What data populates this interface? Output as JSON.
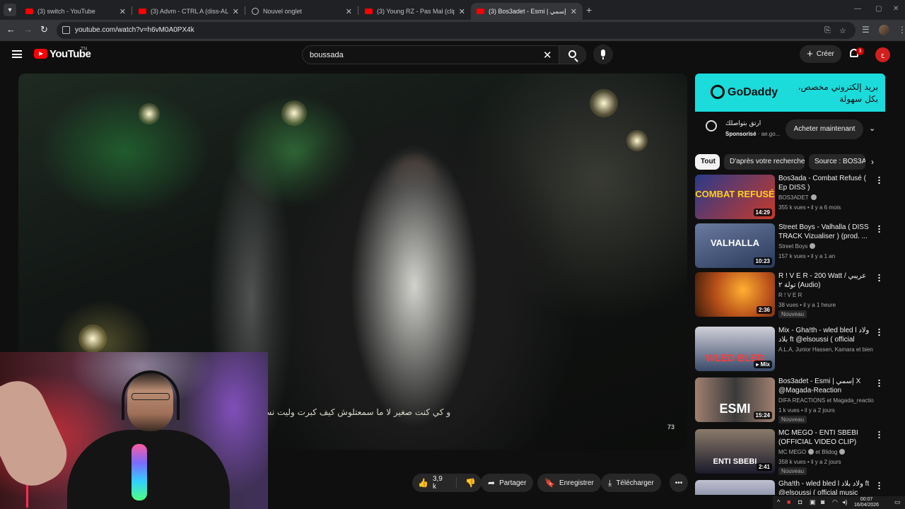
{
  "browser": {
    "tabs": [
      {
        "title": "(3) switch - YouTube",
        "type": "youtube",
        "active": false
      },
      {
        "title": "(3) Advm - CTRL A (diss-ALL) -",
        "type": "youtube",
        "active": false
      },
      {
        "title": "Nouvel onglet",
        "type": "globe",
        "active": false
      },
      {
        "title": "(3) Young RZ - Pas Mal (clip offi",
        "type": "youtube",
        "active": false
      },
      {
        "title": "(3) Bos3adet - Esmi | إسمي ( Of",
        "type": "youtube",
        "active": true
      }
    ],
    "url": "youtube.com/watch?v=h6vM0A0PX4k"
  },
  "header": {
    "logo_text": "YouTube",
    "country": "TN",
    "search_query": "boussada",
    "create_label": "Créer",
    "notification_count": "3",
    "avatar_letter": "خ"
  },
  "video": {
    "subtitle": "و كي كنت صغير لا ما سمعتلوش كيف كبرت وليت نسمع",
    "watermark": "73"
  },
  "actions": {
    "likes": "3,9 k",
    "share": "Partager",
    "save": "Enregistrer",
    "download": "Télécharger"
  },
  "ad": {
    "brand": "GoDaddy",
    "banner_text_line1": "بريد إلكتروني مخصص،",
    "banner_text_line2": "بكل سهولة",
    "title": "ارتق بتواصلك",
    "sponsored": "Sponsorisé",
    "domain": "ae.go...",
    "cta": "Acheter maintenant"
  },
  "chips": [
    "Tout",
    "D'après votre recherche",
    "Source : BOS3ADET"
  ],
  "recommendations": [
    {
      "title": "Bos3ada - Combat Refusé ( Ep DISS )",
      "channel": "BOS3ADET",
      "verified": true,
      "views": "355 k vues",
      "age": "il y a 6 mois",
      "duration": "14:29",
      "thumb_text": "COMBAT REFUSÉ",
      "badge": "",
      "colors": [
        "#2a3a8a",
        "#c83a2a"
      ]
    },
    {
      "title": "Street Boys - Valhalla ( DISS TRACK Vizualiser ) (prod. ...",
      "channel": "Street Boys",
      "verified": true,
      "views": "157 k vues",
      "age": "il y a 1 an",
      "duration": "10:23",
      "thumb_text": "VALHALLA",
      "badge": "",
      "colors": [
        "#2a3a5a",
        "#6a7aa0"
      ]
    },
    {
      "title": "R ! V E R - 200 Watt / عريبي تولة ٢ (Audio)",
      "channel": "R ! V E R",
      "verified": false,
      "views": "38 vues",
      "age": "il y a 1 heure",
      "duration": "2:36",
      "thumb_text": "",
      "badge": "Nouveau",
      "colors": [
        "#b8501a",
        "#ffb030"
      ]
    },
    {
      "title": "Mix - Gha!th - wled bled l ولاد بلاد ft @elsoussi ( official music ...",
      "channel": "A.L.A, Junior Hassen, Kamara et bien plus",
      "verified": false,
      "views": "",
      "age": "",
      "duration": "Mix",
      "thumb_text": "WLED BLED",
      "badge": "",
      "colors": [
        "#3a4a6a",
        "#d0d0d8"
      ]
    },
    {
      "title": "Bos3adet - Esmi | إسمي X @Magada-Reaction REACTIO...",
      "channel": "DIFA REACTIONS et Magada_reaction",
      "verified": false,
      "views": "1 k vues",
      "age": "il y a 2 jours",
      "duration": "15:24",
      "thumb_text": "ESMI",
      "badge": "Nouveau",
      "colors": [
        "#3a3a3a",
        "#a08070"
      ]
    },
    {
      "title": "MC MEGO - ENTI SBEBI (OFFICIAL VIDEO CLIP)",
      "channel": "MC MEGO",
      "channel2": "et Blidog",
      "verified": true,
      "views": "358 k vues",
      "age": "il y a 2 jours",
      "duration": "2:41",
      "thumb_text": "ENTI SBEBI",
      "badge": "Nouveau",
      "colors": [
        "#1a1a2a",
        "#8a7a6a"
      ]
    },
    {
      "title": "Gha!th - wled bled l ولاد بلاد ft @elsoussi ( official music vid...",
      "channel": "",
      "verified": false,
      "views": "",
      "age": "",
      "duration": "",
      "thumb_text": "",
      "badge": "",
      "colors": [
        "#3a4a6a",
        "#c0c0d0"
      ]
    }
  ],
  "taskbar": {
    "time": "00:07",
    "date": "16/04/2026"
  },
  "colors": {
    "yt_red": "#ff0000",
    "bg": "#0f0f0f",
    "ad_cyan": "#1bdbdb"
  }
}
